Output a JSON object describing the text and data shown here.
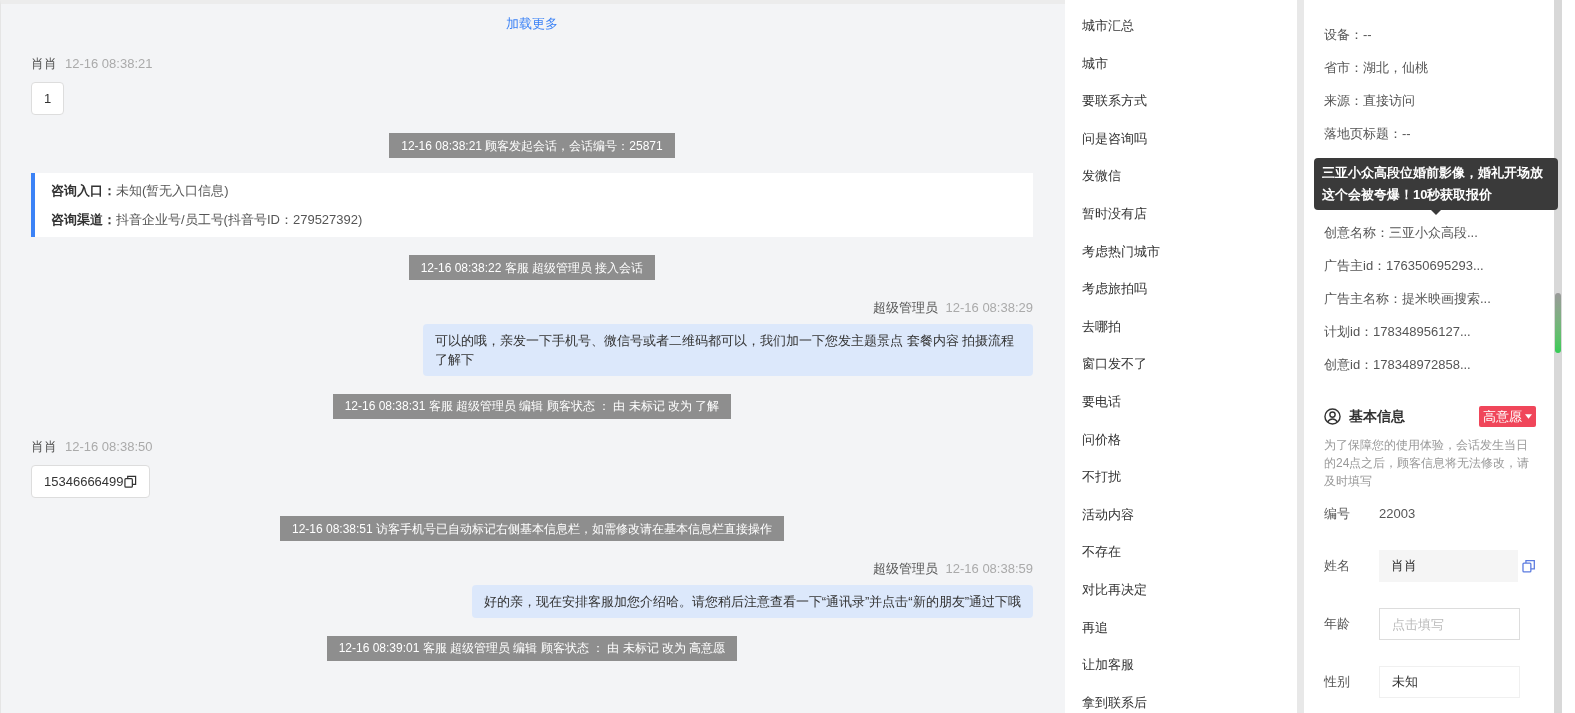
{
  "chat": {
    "load_more": "加载更多",
    "messages": [
      {
        "kind": "customer",
        "sender": "肖肖",
        "time": "12-16 08:38:21",
        "text": "1",
        "copyable": false
      },
      {
        "kind": "system",
        "text": "12-16 08:38:21 顾客发起会话，会话编号：25871"
      },
      {
        "kind": "info",
        "lines": [
          {
            "label": "咨询入口：",
            "value": "未知(暂无入口信息)"
          },
          {
            "label": "咨询渠道：",
            "value": "抖音企业号/员工号(抖音号ID：279527392)"
          }
        ]
      },
      {
        "kind": "system",
        "text": "12-16 08:38:22 客服 超级管理员 接入会话"
      },
      {
        "kind": "agent",
        "sender": "超级管理员",
        "time": "12-16 08:38:29",
        "text": "可以的哦，亲发一下手机号、微信号或者二维码都可以，我们加一下您发主题景点 套餐内容 拍摄流程了解下"
      },
      {
        "kind": "system",
        "text": "12-16 08:38:31 客服 超级管理员 编辑 顾客状态 ： 由 未标记 改为 了解"
      },
      {
        "kind": "customer",
        "sender": "肖肖",
        "time": "12-16 08:38:50",
        "text": "15346666499",
        "copyable": true
      },
      {
        "kind": "system",
        "text": "12-16 08:38:51 访客手机号已自动标记右侧基本信息栏，如需修改请在基本信息栏直接操作"
      },
      {
        "kind": "agent",
        "sender": "超级管理员",
        "time": "12-16 08:38:59",
        "text": "好的亲，现在安排客服加您介绍哈。请您稍后注意查看一下“通讯录”并点击“新的朋友”通过下哦"
      },
      {
        "kind": "system",
        "text": "12-16 08:39:01 客服 超级管理员 编辑 顾客状态 ： 由 未标记 改为 高意愿"
      }
    ]
  },
  "quick_replies": [
    "城市汇总",
    "城市",
    "要联系方式",
    "问是咨询吗",
    "发微信",
    "暂时没有店",
    "考虑热门城市",
    "考虑旅拍吗",
    "去哪拍",
    "窗口发不了",
    "要电话",
    "问价格",
    "不打扰",
    "活动内容",
    "不存在",
    "对比再决定",
    "再追",
    "让加客服",
    "拿到联系后"
  ],
  "source_info": {
    "rows_top": [
      "设备：--",
      "省市：湖北，仙桃",
      "来源：直接访问",
      "落地页标题：--"
    ],
    "tooltip": "三亚小众高段位婚前影像，婚礼开场放这个会被夸爆！10秒获取报价",
    "rows_bottom": [
      "创意名称：三亚小众高段...",
      "广告主id：176350695293...",
      "广告主名称：提米映画搜索...",
      "计划id：178348956127...",
      "创意id：178348972858..."
    ]
  },
  "basic_info": {
    "title": "基本信息",
    "intent_tag": "高意愿",
    "note": "为了保障您的使用体验，会话发生当日的24点之后，顾客信息将无法修改，请及时填写",
    "fields": [
      {
        "kind": "text",
        "label": "编号",
        "value": "22003"
      },
      {
        "kind": "readonly",
        "label": "姓名",
        "value": "肖肖"
      },
      {
        "kind": "input",
        "label": "年龄",
        "placeholder": "点击填写"
      },
      {
        "kind": "select",
        "label": "性别",
        "value": "未知"
      }
    ]
  }
}
